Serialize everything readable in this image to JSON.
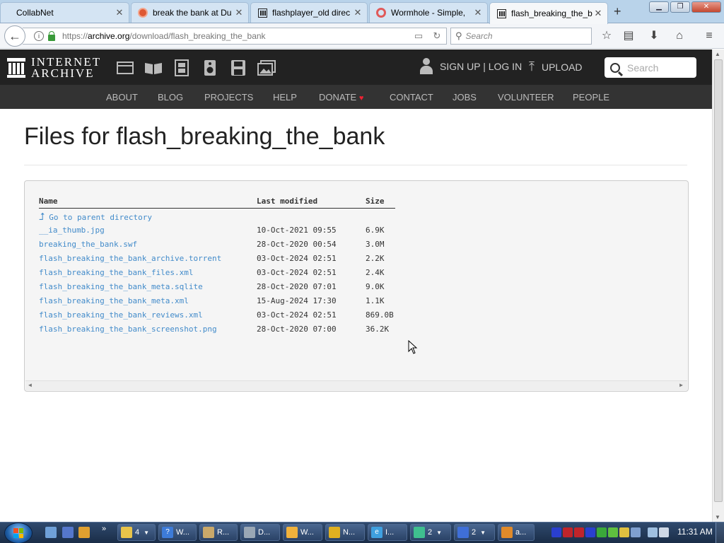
{
  "browser": {
    "tabs": [
      {
        "title": "CollabNet",
        "icon": "none"
      },
      {
        "title": "break the bank at Du",
        "icon": "duckduckgo-icon"
      },
      {
        "title": "flashplayer_old direc",
        "icon": "internet-archive-icon"
      },
      {
        "title": "Wormhole - Simple,",
        "icon": "wormhole-icon"
      },
      {
        "title": "flash_breaking_the_b",
        "icon": "internet-archive-icon",
        "active": true
      }
    ],
    "new_tab_label": "+",
    "url_prefix": "https://",
    "url_host": "archive.org",
    "url_path": "/download/flash_breaking_the_bank",
    "search_placeholder": "Search"
  },
  "ia_header": {
    "logo_line1": "INTERNET",
    "logo_line2": "ARCHIVE",
    "media_icons": [
      "web-icon",
      "texts-icon",
      "video-icon",
      "audio-icon",
      "software-icon",
      "images-icon"
    ],
    "signin_label": "SIGN UP | LOG IN",
    "upload_label": "UPLOAD",
    "search_placeholder": "Search"
  },
  "ia_nav": {
    "items": [
      "ABOUT",
      "BLOG",
      "PROJECTS",
      "HELP",
      "DONATE",
      "CONTACT",
      "JOBS",
      "VOLUNTEER",
      "PEOPLE"
    ]
  },
  "page": {
    "title": "Files for flash_breaking_the_bank"
  },
  "listing": {
    "headers": {
      "name": "Name",
      "modified": "Last modified",
      "size": "Size"
    },
    "parent_label": "Go to parent directory",
    "files": [
      {
        "name": "__ia_thumb.jpg",
        "modified": "10-Oct-2021 09:55",
        "size": "6.9K"
      },
      {
        "name": "breaking_the_bank.swf",
        "modified": "28-Oct-2020 00:54",
        "size": "3.0M"
      },
      {
        "name": "flash_breaking_the_bank_archive.torrent",
        "modified": "03-Oct-2024 02:51",
        "size": "2.2K"
      },
      {
        "name": "flash_breaking_the_bank_files.xml",
        "modified": "03-Oct-2024 02:51",
        "size": "2.4K"
      },
      {
        "name": "flash_breaking_the_bank_meta.sqlite",
        "modified": "28-Oct-2020 07:01",
        "size": "9.0K"
      },
      {
        "name": "flash_breaking_the_bank_meta.xml",
        "modified": "15-Aug-2024 17:30",
        "size": "1.1K"
      },
      {
        "name": "flash_breaking_the_bank_reviews.xml",
        "modified": "03-Oct-2024 02:51",
        "size": "869.0B"
      },
      {
        "name": "flash_breaking_the_bank_screenshot.png",
        "modified": "28-Oct-2020 07:00",
        "size": "36.2K"
      }
    ]
  },
  "taskbar": {
    "buttons": [
      {
        "label": "4",
        "icon_color": "#e8c34a",
        "dropdown": true
      },
      {
        "label": "W...",
        "icon_color": "#3d7bd8"
      },
      {
        "label": "R...",
        "icon_color": "#c9a86a"
      },
      {
        "label": "D...",
        "icon_color": "#9aa7b5"
      },
      {
        "label": "W...",
        "icon_color": "#f0b23c"
      },
      {
        "label": "N...",
        "icon_color": "#e0b020"
      },
      {
        "label": "I...",
        "icon_color": "#3fa0e0"
      },
      {
        "label": "2",
        "icon_color": "#3fbf8f",
        "dropdown": true
      },
      {
        "label": "2",
        "icon_color": "#3f6fd8",
        "dropdown": true
      },
      {
        "label": "a...",
        "icon_color": "#e08a2a"
      }
    ],
    "clock": "11:31 AM"
  }
}
